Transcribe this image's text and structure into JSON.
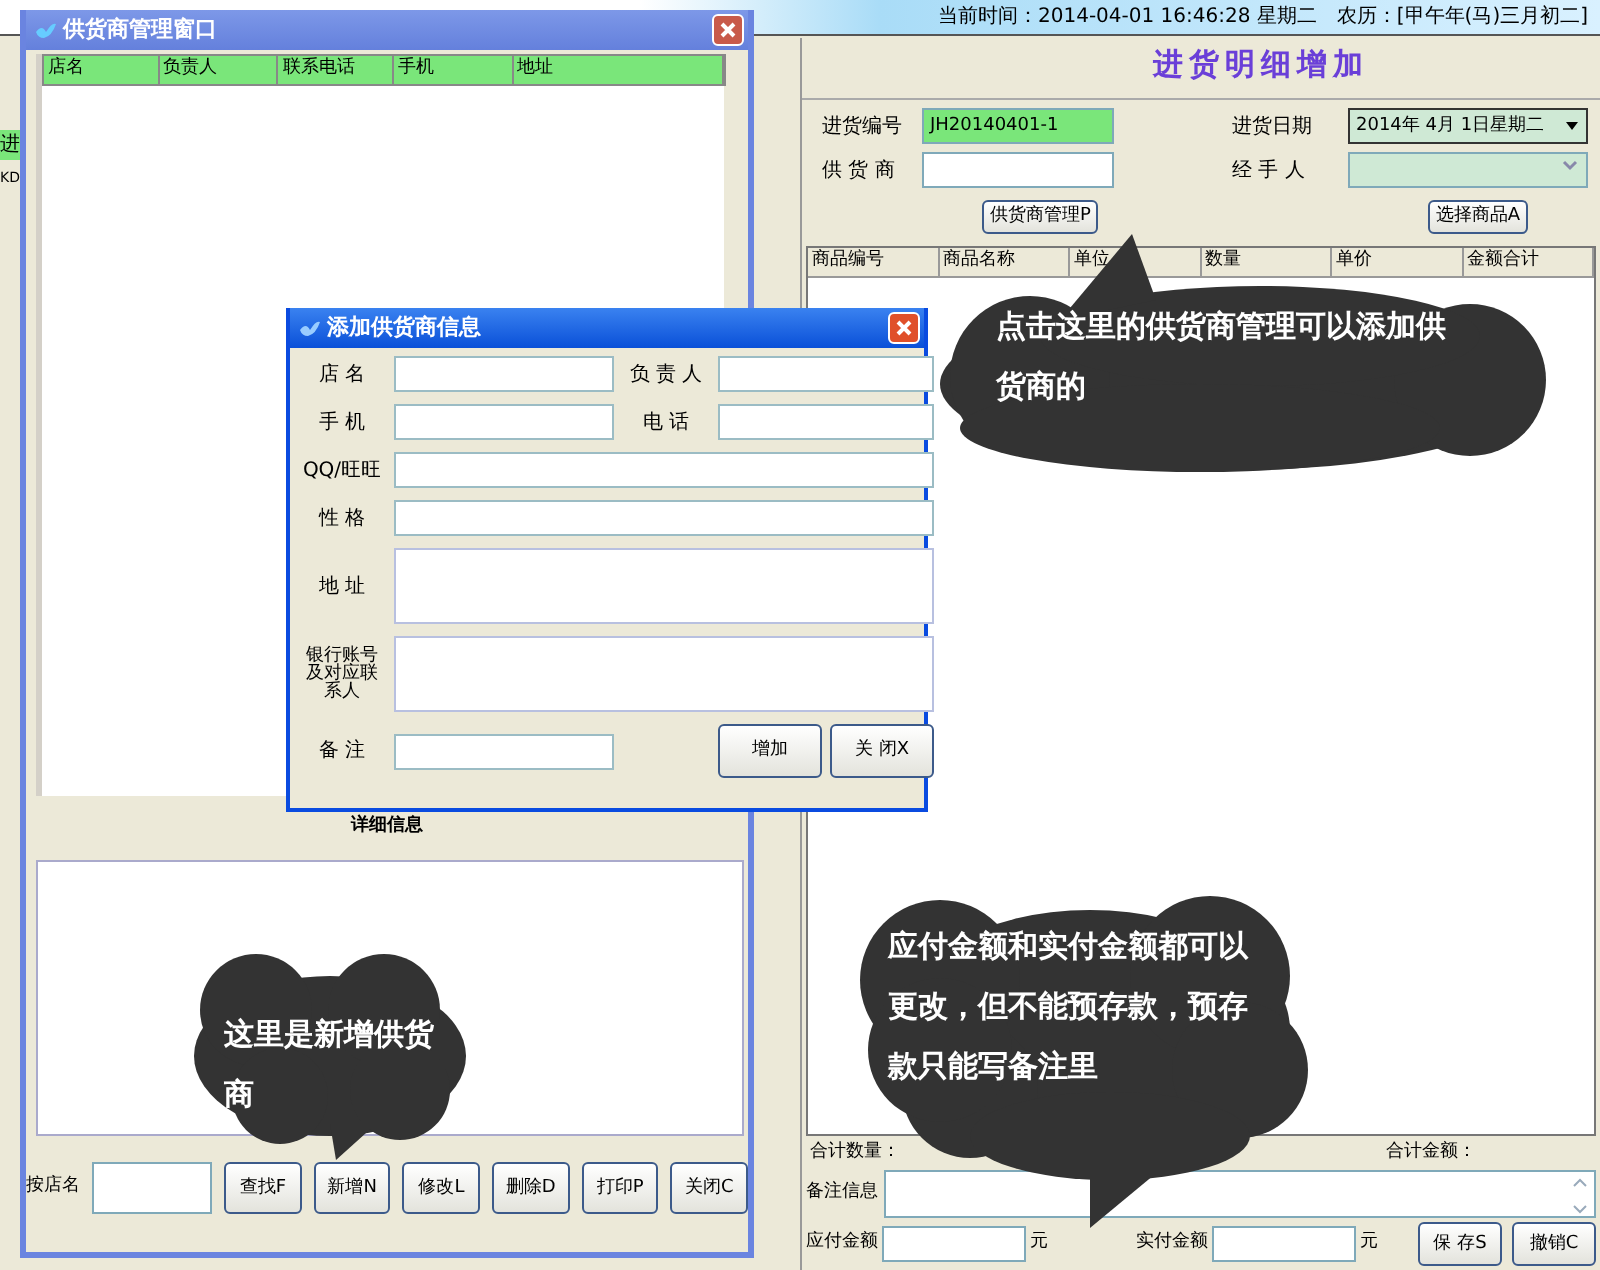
{
  "background_window": {
    "header": "进",
    "cell": "KD"
  },
  "main_window": {
    "clock": "当前时间：2014-04-01 16:46:28 星期二",
    "lunar": "农历：[甲午年(马)三月初二]",
    "title": "进货明细增加",
    "fields": [
      {
        "label": "进货编号",
        "value": "JH20140401-1",
        "kind": "text",
        "highlighted": true
      },
      {
        "label": "进货日期",
        "value": "2014年 4月 1日星期二",
        "kind": "date"
      },
      {
        "label": "供 货 商",
        "kind": "text",
        "highlighted": false
      },
      {
        "label": "经 手 人",
        "kind": "combo"
      }
    ],
    "buttons": [
      "供货商管理P",
      "选择商品A"
    ],
    "columns": [
      "商品编号",
      "商品名称",
      "单位",
      "数量",
      "单价",
      "金额合计"
    ],
    "total_quantity_label": "合计数量：",
    "total_amount_label": "合计金额：",
    "remarks_label": "备注信息",
    "payable_label": "应付金额",
    "payable_unit": "元",
    "paid_label": "实付金额",
    "paid_unit": "元",
    "footer_buttons": [
      "保 存S",
      "撤销C"
    ]
  },
  "supplier_window": {
    "title": "供货商管理窗口",
    "columns": [
      "店名",
      "负责人",
      "联系电话",
      "手机",
      "地址"
    ],
    "detail_label": "详细信息",
    "search_label": "按店名",
    "buttons": [
      "查找F",
      "新增N",
      "修改L",
      "删除D",
      "打印P",
      "关闭C"
    ]
  },
  "dialog": {
    "title": "添加供货商信息",
    "fields": [
      {
        "label": "店 名",
        "kind": "half"
      },
      {
        "label": "负 责 人",
        "kind": "half"
      },
      {
        "label": "手 机",
        "kind": "half"
      },
      {
        "label": "电 话",
        "kind": "half"
      },
      {
        "label": "QQ/旺旺",
        "kind": "full"
      },
      {
        "label": "性 格",
        "kind": "full"
      },
      {
        "label": "地 址",
        "kind": "tall"
      },
      {
        "label": "银行账号及对应联系人",
        "kind": "tall"
      },
      {
        "label": "备 注",
        "kind": "half"
      }
    ],
    "buttons": [
      "增加",
      "关 闭X"
    ]
  },
  "callouts": [
    "点击这里的供货商管理可以添加供货商的",
    "应付金额和实付金额都可以更改，但不能预存款，预存款只能写备注里",
    "这里是新增供货商"
  ]
}
